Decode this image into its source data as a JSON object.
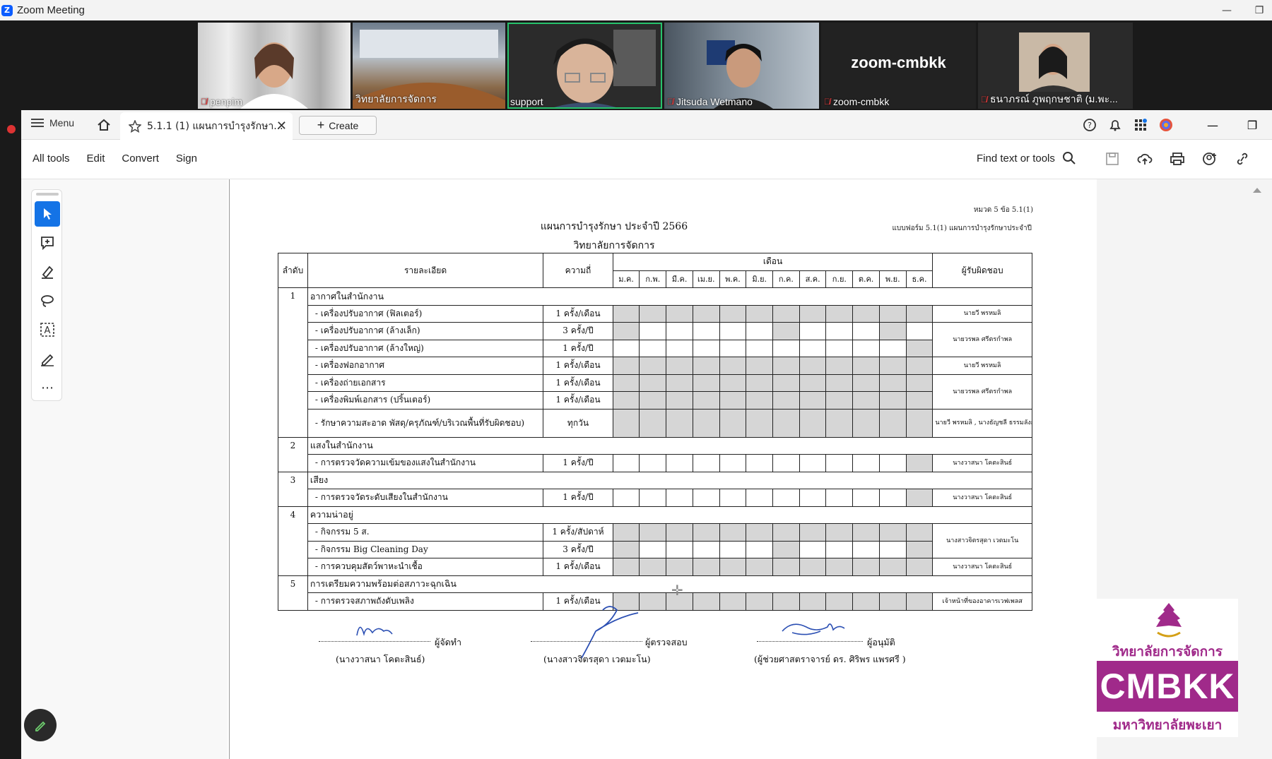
{
  "zoom": {
    "title": "Zoom Meeting",
    "participants": [
      {
        "name": "penpim",
        "muted": true
      },
      {
        "name": "วิทยาลัยการจัดการ",
        "muted": false
      },
      {
        "name": "support",
        "muted": false,
        "active": true
      },
      {
        "name": "Jitsuda Wetmano",
        "muted": true
      },
      {
        "name": "zoom-cmbkk",
        "muted": true,
        "video_off": true,
        "big_label": "zoom-cmbkk"
      },
      {
        "name": "ธนาภรณ์ ภูพฤกษชาติ (ม.พะ...",
        "muted": true
      }
    ]
  },
  "acrobat": {
    "menu_label": "Menu",
    "tab_title": "5.1.1 (1) แผนการบำรุงรักษา...",
    "create_label": "Create",
    "menu_items": [
      "All tools",
      "Edit",
      "Convert",
      "Sign"
    ],
    "find_label": "Find text or tools"
  },
  "document": {
    "ref_top": "หมวด 5 ข้อ 5.1(1)",
    "ref_form": "แบบฟอร์ม 5.1(1) แผนการบำรุงรักษาประจำปี",
    "title": "แผนการบำรุงรักษา ประจำปี 2566",
    "subtitle": "วิทยาลัยการจัดการ",
    "headers": {
      "no": "ลำดับ",
      "detail": "รายละเอียด",
      "freq": "ความถี่",
      "months_group": "เดือน",
      "resp": "ผู้รับผิดชอบ"
    },
    "months": [
      "ม.ค.",
      "ก.พ.",
      "มี.ค.",
      "เม.ย.",
      "พ.ค.",
      "มิ.ย.",
      "ก.ค.",
      "ส.ค.",
      "ก.ย.",
      "ต.ค.",
      "พ.ย.",
      "ธ.ค."
    ],
    "sections": [
      {
        "no": "1",
        "title": "อากาศในสำนักงาน",
        "rows": [
          {
            "detail": "- เครื่องปรับอากาศ (ฟิลเตอร์)",
            "freq": "1 ครั้ง/เดือน",
            "marks": [
              1,
              1,
              1,
              1,
              1,
              1,
              1,
              1,
              1,
              1,
              1,
              1
            ],
            "resp": "นายวี พรหมลิ"
          },
          {
            "detail": "- เครื่องปรับอากาศ (ล้างเล็ก)",
            "freq": "3 ครั้ง/ปี",
            "marks": [
              1,
              0,
              0,
              0,
              0,
              0,
              1,
              0,
              0,
              0,
              1,
              0
            ],
            "resp": "นายวรพล ศรีตรกำพล"
          },
          {
            "detail": "- เครื่องปรับอากาศ (ล้างใหญ่)",
            "freq": "1 ครั้ง/ปี",
            "marks": [
              0,
              0,
              0,
              0,
              0,
              0,
              0,
              0,
              0,
              0,
              0,
              1
            ],
            "resp": ""
          },
          {
            "detail": "- เครื่องฟอกอากาศ",
            "freq": "1 ครั้ง/เดือน",
            "marks": [
              1,
              1,
              1,
              1,
              1,
              1,
              1,
              1,
              1,
              1,
              1,
              1
            ],
            "resp": "นายวี พรหมลิ"
          },
          {
            "detail": "- เครื่องถ่ายเอกสาร",
            "freq": "1 ครั้ง/เดือน",
            "marks": [
              1,
              1,
              1,
              1,
              1,
              1,
              1,
              1,
              1,
              1,
              1,
              1
            ],
            "resp": "นายวรพล ศรีตรกำพล"
          },
          {
            "detail": "- เครื่องพิมพ์เอกสาร (ปริ้นเตอร์)",
            "freq": "1 ครั้ง/เดือน",
            "marks": [
              1,
              1,
              1,
              1,
              1,
              1,
              1,
              1,
              1,
              1,
              1,
              1
            ],
            "resp": ""
          },
          {
            "detail": "- รักษาความสะอาด พัสดุ/ครุภัณฑ์/บริเวณพื้นที่รับผิดชอบ)",
            "freq": "ทุกวัน",
            "marks": [
              1,
              1,
              1,
              1,
              1,
              1,
              1,
              1,
              1,
              1,
              1,
              1
            ],
            "resp": "นายวี พรหมลิ , นางธัญชลี ธรรมลังกา",
            "tall": true
          }
        ]
      },
      {
        "no": "2",
        "title": "แสงในสำนักงาน",
        "rows": [
          {
            "detail": "- การตรวจวัดความเข้มของแสงในสำนักงาน",
            "freq": "1 ครั้ง/ปี",
            "marks": [
              0,
              0,
              0,
              0,
              0,
              0,
              0,
              0,
              0,
              0,
              0,
              1
            ],
            "resp": "นางวาสนา โคตะสินธ์"
          }
        ]
      },
      {
        "no": "3",
        "title": "เสียง",
        "rows": [
          {
            "detail": "- การตรวจวัดระดับเสียงในสำนักงาน",
            "freq": "1 ครั้ง/ปี",
            "marks": [
              0,
              0,
              0,
              0,
              0,
              0,
              0,
              0,
              0,
              0,
              0,
              1
            ],
            "resp": "นางวาสนา โคตะสินธ์"
          }
        ]
      },
      {
        "no": "4",
        "title": "ความน่าอยู่",
        "rows": [
          {
            "detail": "- กิจกรรม 5 ส.",
            "freq": "1 ครั้ง/สัปดาห์",
            "marks": [
              1,
              1,
              1,
              1,
              1,
              1,
              1,
              1,
              1,
              1,
              1,
              1
            ],
            "resp": "นางสาวจิตรสุดา เวตมะโน"
          },
          {
            "detail": "- กิจกรรม Big Cleaning  Day",
            "freq": "3 ครั้ง/ปี",
            "marks": [
              1,
              0,
              0,
              0,
              0,
              0,
              1,
              0,
              0,
              0,
              0,
              1
            ],
            "resp": ""
          },
          {
            "detail": "- การควบคุมสัตว์พาหะนำเชื้อ",
            "freq": "1 ครั้ง/เดือน",
            "marks": [
              1,
              1,
              1,
              1,
              1,
              1,
              1,
              1,
              1,
              1,
              1,
              1
            ],
            "resp": "นางวาสนา โคตะสินธ์"
          }
        ]
      },
      {
        "no": "5",
        "title": "การเตรียมความพร้อมต่อสภาวะฉุกเฉิน",
        "rows": [
          {
            "detail": "- การตรวจสภาพถังดับเพลิง",
            "freq": "1 ครั้ง/เดือน",
            "marks": [
              1,
              1,
              1,
              1,
              1,
              1,
              1,
              1,
              1,
              1,
              1,
              1
            ],
            "resp": "เจ้าหน้าที่ของอาคารเวฟเพลส"
          }
        ]
      }
    ],
    "signatures": [
      {
        "role": "ผู้จัดทำ",
        "name": "(นางวาสนา  โคตะสินธ์)"
      },
      {
        "role": "ผู้ตรวจสอบ",
        "name": "(นางสาวจิตรสุดา เวตมะโน)"
      },
      {
        "role": "ผู้อนุมัติ",
        "name": "(ผู้ช่วยศาสตราจารย์ ดร. ศิริพร แพรศรี )"
      }
    ]
  },
  "overlay": {
    "line1": "วิทยาลัยการจัดการ",
    "brand": "CMBKK",
    "line2": "มหาวิทยาลัยพะเยา",
    "brand_color": "#a02a8a"
  }
}
